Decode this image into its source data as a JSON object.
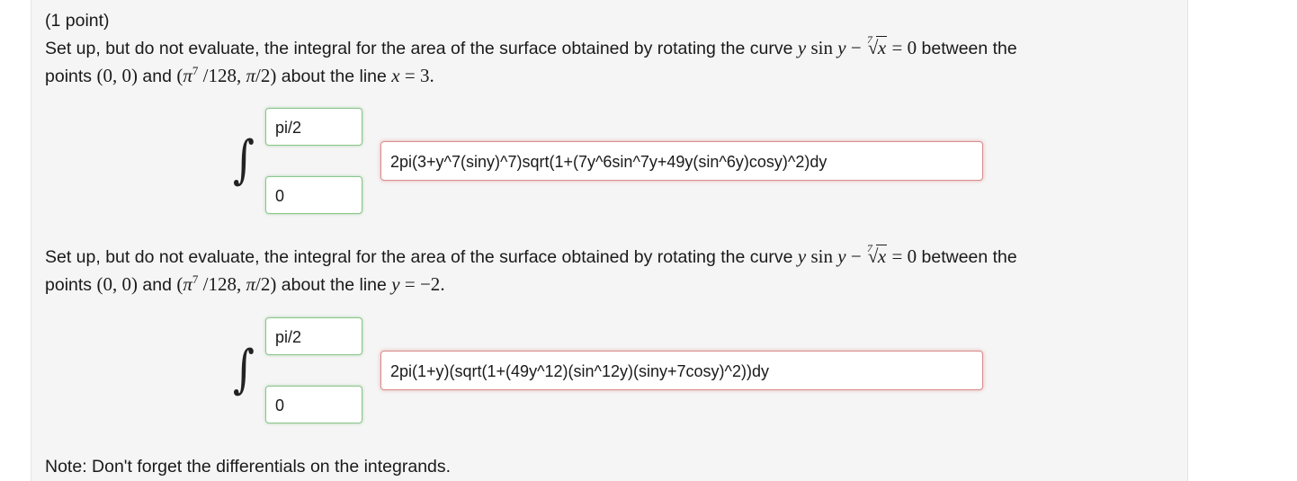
{
  "problem": {
    "points_label": "(1 point)",
    "note": "Note: Don't forget the differentials on the integrands."
  },
  "parts": [
    {
      "intro": "Set up, but do not evaluate, the integral for the area of the surface obtained by rotating the curve",
      "after_curve": "between the",
      "points_word": "points",
      "and_word": "and",
      "axis_text": "about the line",
      "axis_var": "x",
      "axis_value": "3",
      "upper_limit": "pi/2",
      "lower_limit": "0",
      "integrand": "2pi(3+y^7(siny)^7)sqrt(1+(7y^6sin^7y+49y(sin^6y)cosy)^2)dy"
    },
    {
      "intro": "Set up, but do not evaluate, the integral for the area of the surface obtained by rotating the curve",
      "after_curve": "between the",
      "points_word": "points",
      "and_word": "and",
      "axis_text": "about the line",
      "axis_var": "y",
      "axis_value": "−2",
      "upper_limit": "pi/2",
      "lower_limit": "0",
      "integrand": "2pi(1+y)(sqrt(1+(49y^12)(sin^12y)(siny+7cosy)^2))dy"
    }
  ],
  "colors": {
    "panel_background": "#f5f5f5",
    "correct_border": "#8bc58b",
    "incorrect_border": "#d98c8c"
  }
}
